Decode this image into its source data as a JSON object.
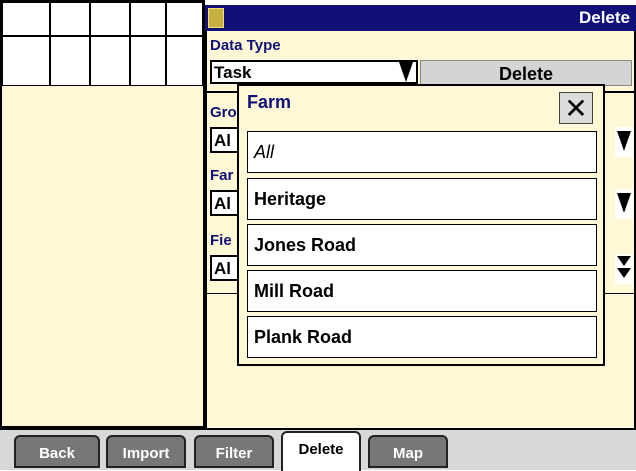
{
  "header": {
    "title": "Delete",
    "icon": "file-icon"
  },
  "form": {
    "data_type_label": "Data Type",
    "data_type_value": "Task",
    "group_label": "Gro",
    "group_value": "Al",
    "farm_label": "Far",
    "farm_value": "Al",
    "field_label": "Fie",
    "field_value": "Al",
    "delete_button": "Delete"
  },
  "modal": {
    "title": "Farm",
    "close_glyph": "✕",
    "options": [
      "All",
      "Heritage",
      "Jones Road",
      "Mill Road",
      "Plank Road"
    ]
  },
  "tabs": [
    "Back",
    "Import",
    "Filter",
    "Delete",
    "Map"
  ],
  "colors": {
    "accent": "#101078",
    "panel": "#fff8d6"
  }
}
